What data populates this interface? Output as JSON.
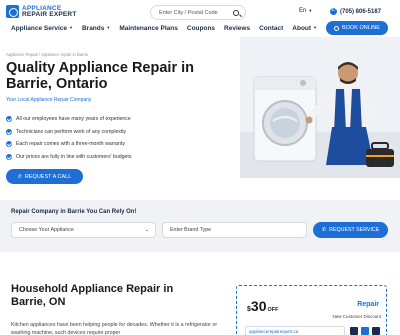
{
  "brand": {
    "line1": "APPLIANCE",
    "line2": "REPAIR EXPERT"
  },
  "search": {
    "placeholder": "Enter City / Postal Code"
  },
  "language": "En",
  "phone": "(705) 806-5187",
  "nav": [
    {
      "label": "Appliance Service",
      "dropdown": true
    },
    {
      "label": "Brands",
      "dropdown": true
    },
    {
      "label": "Maintenance Plans",
      "dropdown": false
    },
    {
      "label": "Coupons",
      "dropdown": false
    },
    {
      "label": "Reviews",
      "dropdown": false
    },
    {
      "label": "Contact",
      "dropdown": false
    },
    {
      "label": "About",
      "dropdown": true
    }
  ],
  "book_label": "BOOK ONLINE",
  "hero": {
    "breadcrumb": "Appliance Repair / Appliance repair in Barrie",
    "title": "Quality Appliance Repair in Barrie, Ontario",
    "subtitle": "Your Local Appliance Repair Company",
    "features": [
      "All our employees have many years of experience",
      "Technicians can perform work of any complexity",
      "Each repair comes with a three-month warranty",
      "Our prices are fully in line with customers' budgets"
    ],
    "request_label": "REQUEST A CALL"
  },
  "finder": {
    "title": "Repair Company in Barrie You Can Rely On!",
    "appliance_placeholder": "Choose Your Appliance",
    "brand_placeholder": "Enter Brand Type",
    "button_label": "REQUEST SERVICE"
  },
  "section": {
    "title": "Household Appliance Repair in Barrie, ON",
    "text": "Kitchen appliances have been helping people for decades. Whether it is a refrigerator or washing machine, such devices require proper"
  },
  "coupon": {
    "dollar": "$",
    "amount": "30",
    "off": "OFF",
    "label": "Repair",
    "description": "New Customer Discount",
    "url": "appliancerepairexpert.ca"
  },
  "colors": {
    "accent": "#1d6fd6",
    "navy": "#1b2c4a",
    "finder_bg": "#f0f2f5"
  }
}
